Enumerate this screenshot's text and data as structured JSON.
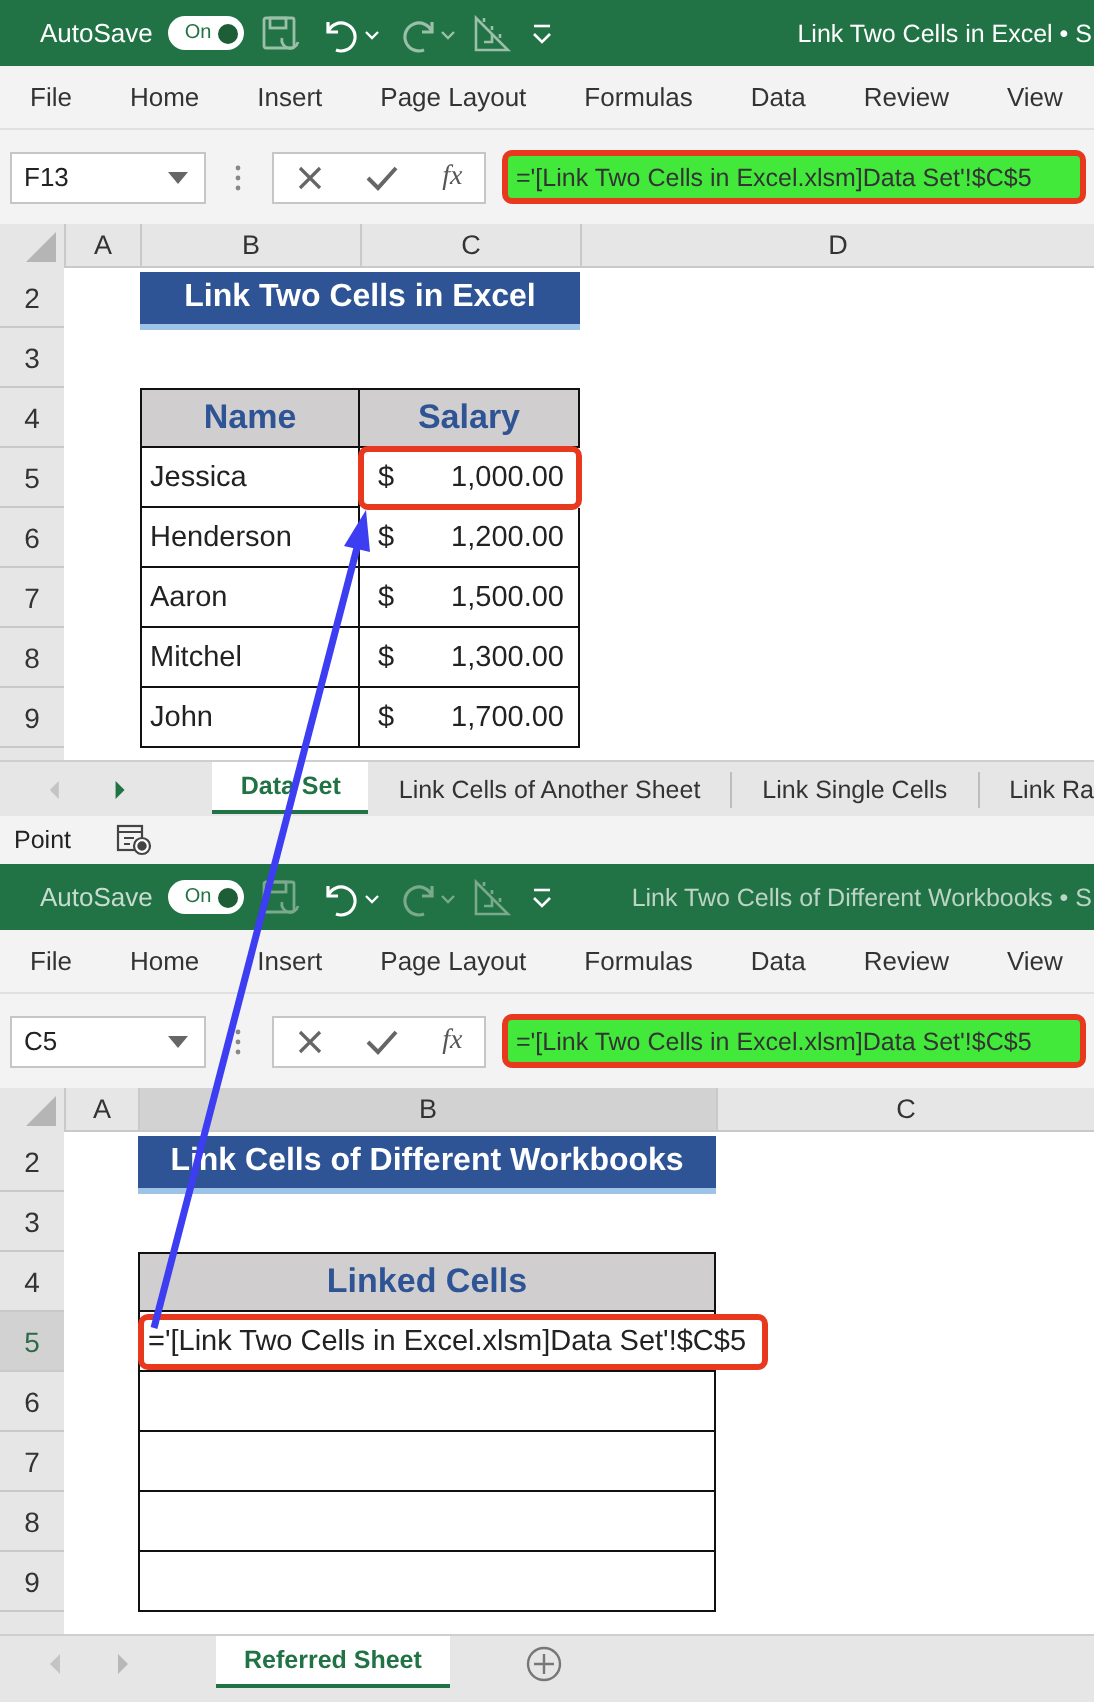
{
  "windows": [
    {
      "active": true,
      "autosave_label": "AutoSave",
      "autosave_on": true,
      "toggle_text": "On",
      "title": "Link Two Cells in Excel • S",
      "ribbon_tabs": [
        "File",
        "Home",
        "Insert",
        "Page Layout",
        "Formulas",
        "Data",
        "Review",
        "View"
      ],
      "name_box": "F13",
      "function_label": "fx",
      "formula": "='[Link Two Cells in Excel.xlsm]Data Set'!$C$5",
      "formula_highlighted": true,
      "columns": [
        {
          "label": "A",
          "selected": false
        },
        {
          "label": "B",
          "selected": false
        },
        {
          "label": "C",
          "selected": false
        },
        {
          "label": "D",
          "selected": false
        }
      ],
      "row_numbers": [
        {
          "label": "2",
          "selected": false
        },
        {
          "label": "3",
          "selected": false
        },
        {
          "label": "4",
          "selected": false
        },
        {
          "label": "5",
          "selected": false
        },
        {
          "label": "6",
          "selected": false
        },
        {
          "label": "7",
          "selected": false
        },
        {
          "label": "8",
          "selected": false
        },
        {
          "label": "9",
          "selected": false
        }
      ],
      "heading": "Link Two Cells in Excel",
      "table": {
        "columns": [
          "Name",
          "Salary"
        ],
        "rows": [
          {
            "kind": "salary",
            "name": "Jessica",
            "currency": "$",
            "amount": "1,000.00",
            "highlighted": true
          },
          {
            "kind": "salary",
            "name": "Henderson",
            "currency": "$",
            "amount": "1,200.00",
            "highlighted": false
          },
          {
            "kind": "salary",
            "name": "Aaron",
            "currency": "$",
            "amount": "1,500.00",
            "highlighted": false
          },
          {
            "kind": "salary",
            "name": "Mitchel",
            "currency": "$",
            "amount": "1,300.00",
            "highlighted": false
          },
          {
            "kind": "salary",
            "name": "John",
            "currency": "$",
            "amount": "1,700.00",
            "highlighted": false
          }
        ]
      },
      "sheet_tabs": [
        {
          "label": "Data Set",
          "selected": true
        },
        {
          "label": "Link Cells of Another Sheet",
          "selected": false
        },
        {
          "label": "Link Single Cells",
          "selected": false
        },
        {
          "label": "Link Ra",
          "selected": false
        }
      ],
      "add_sheet": false,
      "status": "Point"
    },
    {
      "active": false,
      "autosave_label": "AutoSave",
      "autosave_on": true,
      "toggle_text": "On",
      "title": "Link Two Cells of Different Workbooks • S",
      "ribbon_tabs": [
        "File",
        "Home",
        "Insert",
        "Page Layout",
        "Formulas",
        "Data",
        "Review",
        "View"
      ],
      "name_box": "C5",
      "function_label": "fx",
      "formula": "='[Link Two Cells in Excel.xlsm]Data Set'!$C$5",
      "formula_highlighted": true,
      "columns": [
        {
          "label": "A",
          "selected": false
        },
        {
          "label": "B",
          "selected": true
        },
        {
          "label": "C",
          "selected": false
        }
      ],
      "row_numbers": [
        {
          "label": "2",
          "selected": false
        },
        {
          "label": "3",
          "selected": false
        },
        {
          "label": "4",
          "selected": false
        },
        {
          "label": "5",
          "selected": true
        },
        {
          "label": "6",
          "selected": false
        },
        {
          "label": "7",
          "selected": false
        },
        {
          "label": "8",
          "selected": false
        },
        {
          "label": "9",
          "selected": false
        }
      ],
      "heading": "Link Cells of Different Workbooks",
      "table": {
        "columns": [
          "Linked Cells"
        ],
        "rows": [
          {
            "kind": "value",
            "value": "='[Link Two Cells in Excel.xlsm]Data Set'!$C$5",
            "highlighted": true
          },
          {
            "kind": "blank"
          },
          {
            "kind": "blank"
          },
          {
            "kind": "blank"
          },
          {
            "kind": "blank"
          }
        ]
      },
      "sheet_tabs": [
        {
          "label": "Referred Sheet",
          "selected": true
        }
      ],
      "add_sheet": true
    }
  ]
}
